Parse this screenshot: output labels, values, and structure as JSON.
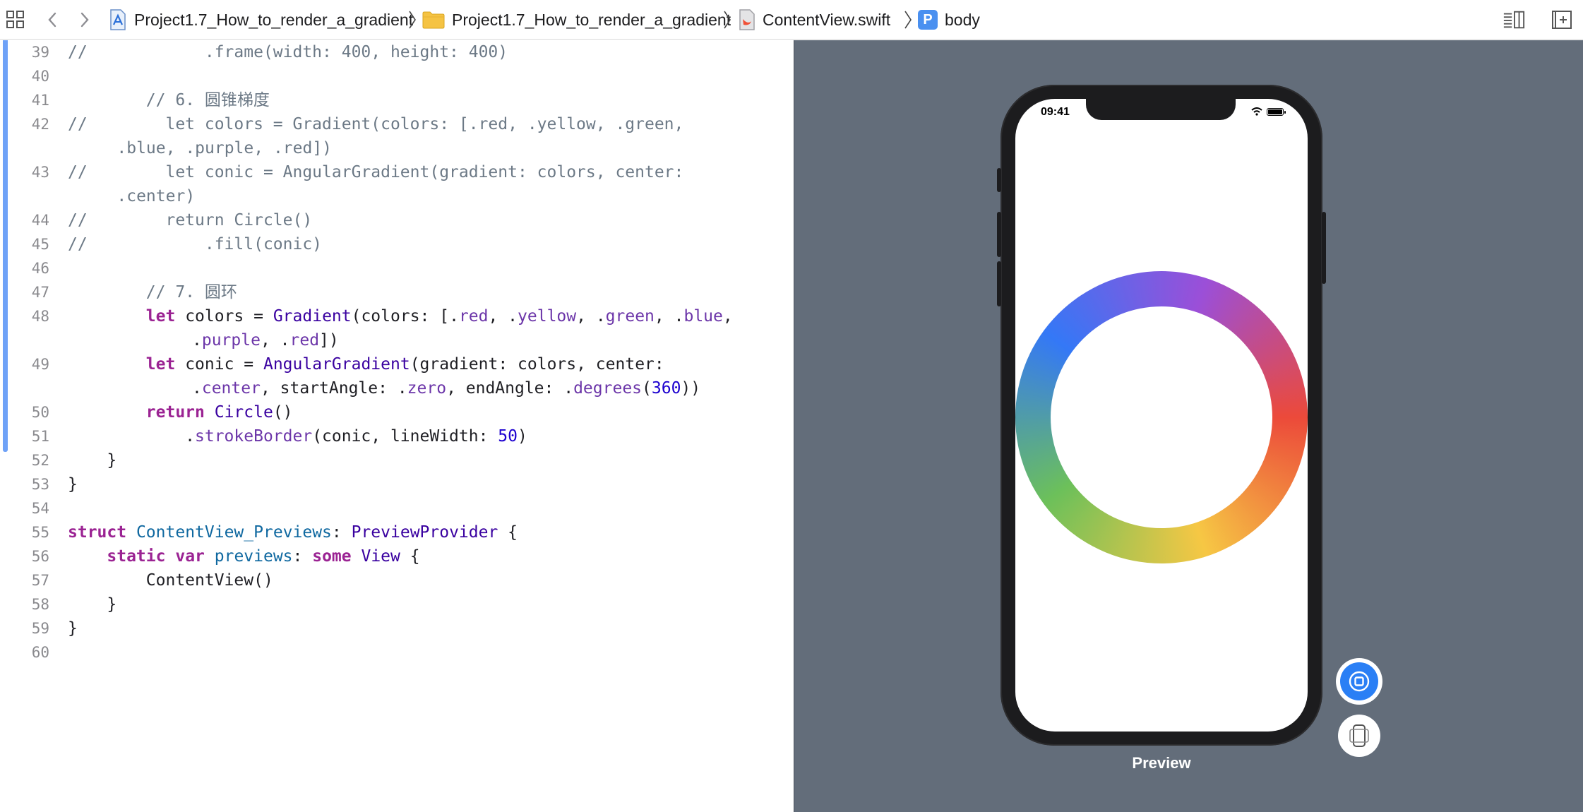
{
  "toolbar": {
    "breadcrumbs": [
      {
        "label": "Project1.7_How_to_render_a_gradient",
        "icon": "xcode-project-icon"
      },
      {
        "label": "Project1.7_How_to_render_a_gradient",
        "icon": "folder-icon"
      },
      {
        "label": "ContentView.swift",
        "icon": "swift-file-icon"
      },
      {
        "label": "body",
        "icon": "property-icon",
        "badge": "P"
      }
    ]
  },
  "editor": {
    "line_numbers": [
      "39",
      "40",
      "41",
      "42",
      "",
      "43",
      "",
      "44",
      "45",
      "46",
      "47",
      "48",
      "",
      "49",
      "",
      "50",
      "51",
      "52",
      "53",
      "54",
      "55",
      "56",
      "57",
      "58",
      "59",
      "60"
    ]
  },
  "code": {
    "l39": "//            .frame(width: 400, height: 400)",
    "l41": "        // 6. 圆锥梯度",
    "l42a": "//        let colors = Gradient(colors: [.red, .yellow, .green,",
    "l42b": "    .blue, .purple, .red])",
    "l43a": "//        let conic = AngularGradient(gradient: colors, center:",
    "l43b": "    .center)",
    "l44": "//        return Circle()",
    "l45": "//            .fill(conic)",
    "l47": "        // 7. 圆环",
    "tok": {
      "let": "let",
      "return": "return",
      "struct": "struct",
      "static": "static",
      "var": "var",
      "some": "some",
      "colors": "colors",
      "conic": "conic",
      "Gradient": "Gradient",
      "AngularGradient": "AngularGradient",
      "Circle": "Circle",
      "ContentView_Previews": "ContentView_Previews",
      "PreviewProvider": "PreviewProvider",
      "previews": "previews",
      "View": "View",
      "ContentView": "ContentView",
      "red": "red",
      "yellow": "yellow",
      "green": "green",
      "blue": "blue",
      "purple": "purple",
      "center": "center",
      "zero": "zero",
      "degrees": "degrees",
      "strokeBorder": "strokeBorder",
      "n360": "360",
      "n50": "50"
    }
  },
  "preview": {
    "status_time": "09:41",
    "label": "Preview",
    "ring_colors": [
      "#ec4a3a",
      "#f6c744",
      "#6cc05a",
      "#3478f6",
      "#9b4fd8",
      "#ec4a3a"
    ]
  }
}
